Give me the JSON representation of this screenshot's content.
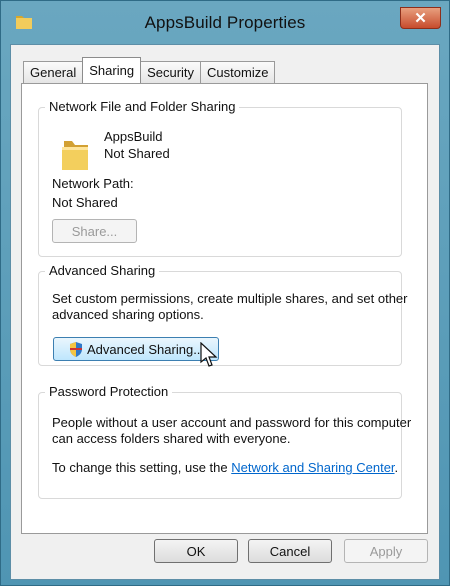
{
  "window": {
    "title": "AppsBuild Properties",
    "close_label": "✕"
  },
  "tabs": [
    {
      "label": "General",
      "active": false
    },
    {
      "label": "Sharing",
      "active": true
    },
    {
      "label": "Security",
      "active": false
    },
    {
      "label": "Customize",
      "active": false
    }
  ],
  "network_sharing": {
    "title": "Network File and Folder Sharing",
    "folder_name": "AppsBuild",
    "folder_status": "Not Shared",
    "path_label": "Network Path:",
    "path_value": "Not Shared",
    "share_button": "Share..."
  },
  "advanced_sharing": {
    "title": "Advanced Sharing",
    "description_line1": "Set custom permissions, create multiple shares, and set other",
    "description_line2": "advanced sharing options.",
    "button": "Advanced Sharing..."
  },
  "password_protection": {
    "title": "Password Protection",
    "description_line1": "People without a user account and password for this computer",
    "description_line2": "can access folders shared with everyone.",
    "change_text": "To change this setting, use the ",
    "link_text": "Network and Sharing Center",
    "period": "."
  },
  "footer": {
    "ok": "OK",
    "cancel": "Cancel",
    "apply": "Apply"
  },
  "colors": {
    "frame": "#5e9fbb",
    "link": "#0066cc",
    "close": "#c74c2d"
  },
  "icons": {
    "title": "folder-icon",
    "folder": "folder-icon",
    "advanced_button": "shield-icon",
    "pointer": "mouse-pointer-icon"
  }
}
